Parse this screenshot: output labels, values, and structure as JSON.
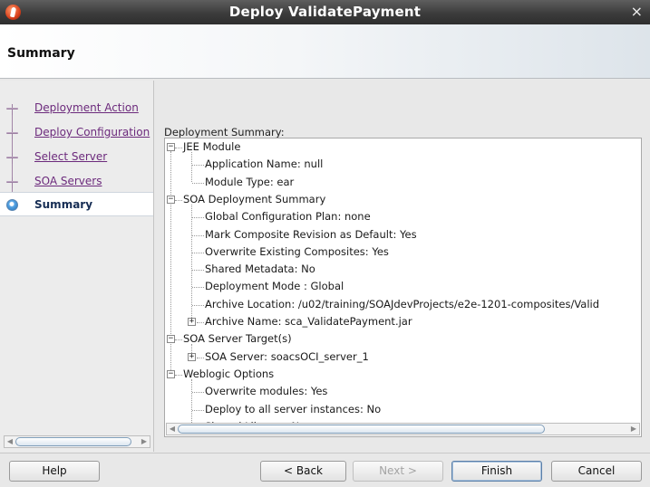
{
  "window": {
    "title": "Deploy ValidatePayment",
    "close": "×"
  },
  "header": {
    "heading": "Summary"
  },
  "sidebar": {
    "items": [
      {
        "label": "Deployment Action",
        "state": "visited"
      },
      {
        "label": "Deploy Configuration",
        "state": "visited"
      },
      {
        "label": "Select Server",
        "state": "visited"
      },
      {
        "label": "SOA Servers",
        "state": "visited"
      },
      {
        "label": "Summary",
        "state": "current"
      }
    ]
  },
  "main": {
    "section_label": "Deployment Summary:",
    "tree": [
      {
        "text": "JEE Module",
        "level": 0,
        "toggle": "−"
      },
      {
        "text": "Application Name: null",
        "level": 1
      },
      {
        "text": "Module Type: ear",
        "level": 1
      },
      {
        "text": "SOA Deployment Summary",
        "level": 0,
        "toggle": "−"
      },
      {
        "text": "Global Configuration Plan: none",
        "level": 1
      },
      {
        "text": "Mark Composite Revision as Default: Yes",
        "level": 1
      },
      {
        "text": "Overwrite Existing Composites: Yes",
        "level": 1
      },
      {
        "text": "Shared Metadata: No",
        "level": 1
      },
      {
        "text": "Deployment Mode : Global",
        "level": 1
      },
      {
        "text": "Archive Location: /u02/training/SOAJdevProjects/e2e-1201-composites/Valid",
        "level": 1
      },
      {
        "text": "Archive Name: sca_ValidatePayment.jar",
        "level": 1,
        "toggle": "+"
      },
      {
        "text": "SOA Server Target(s)",
        "level": 0,
        "toggle": "−"
      },
      {
        "text": "SOA Server: soacsOCI_server_1",
        "level": 1,
        "toggle": "+"
      },
      {
        "text": "Weblogic Options",
        "level": 0,
        "toggle": "−"
      },
      {
        "text": "Overwrite modules: Yes",
        "level": 1
      },
      {
        "text": "Deploy to all server instances: No",
        "level": 1
      },
      {
        "text": "Shared Library : No",
        "level": 1
      }
    ]
  },
  "buttons": {
    "help": "Help",
    "back": "< Back",
    "next": "Next >",
    "finish": "Finish",
    "cancel": "Cancel"
  },
  "colors": {
    "visited_link": "#6c2a7c",
    "current": "#162d54",
    "titlebar": "#3c3c3c"
  }
}
